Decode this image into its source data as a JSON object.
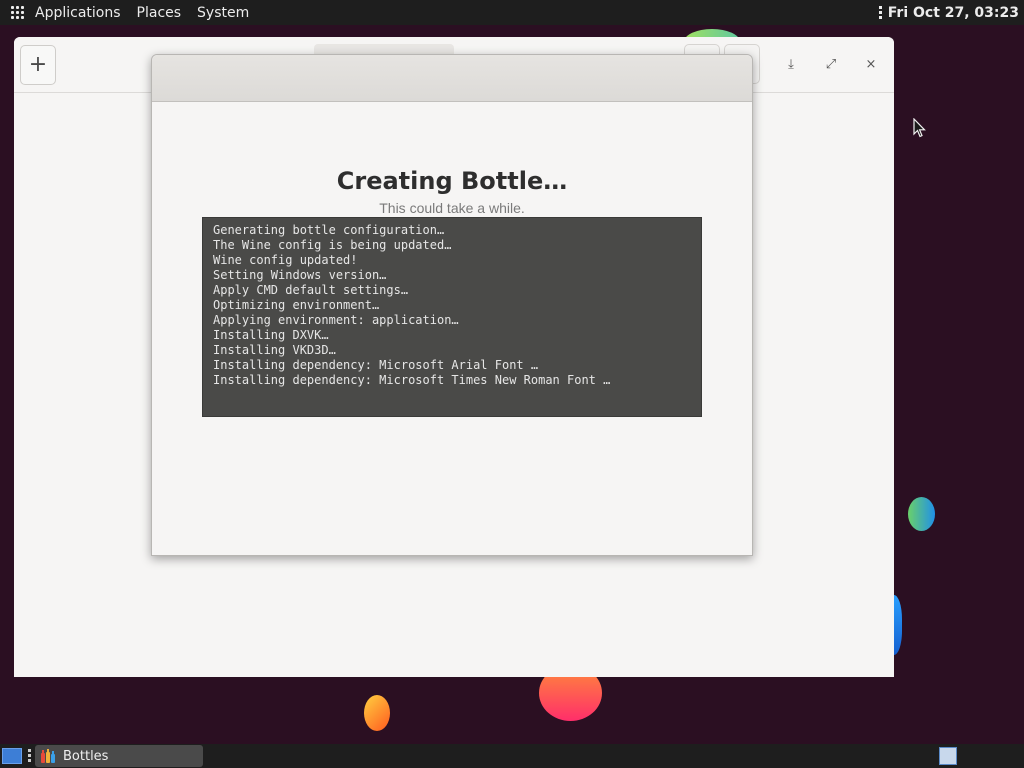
{
  "top_panel": {
    "menu": [
      "Applications",
      "Places",
      "System"
    ],
    "clock": "Fri Oct 27, 03:23"
  },
  "app_window": {
    "add_button_label": "+",
    "controls": {
      "download": "⤓",
      "maximize": "⤢",
      "close": "×"
    }
  },
  "dialog": {
    "title": "Creating Bottle…",
    "subtitle": "This could take a while.",
    "log_lines": [
      "Generating bottle configuration…",
      "The Wine config is being updated…",
      "Wine config updated!",
      "Setting Windows version…",
      "Apply CMD default settings…",
      "Optimizing environment…",
      "Applying environment: application…",
      "Installing DXVK…",
      "Installing VKD3D…",
      "Installing dependency: Microsoft Arial Font …",
      "Installing dependency: Microsoft Times New Roman Font …"
    ]
  },
  "taskbar": {
    "tasks": [
      {
        "label": "Bottles"
      }
    ]
  },
  "icons": {
    "apps": "apps-grid-icon",
    "panel_menu": "vertical-dots-icon",
    "show_desktop": "show-desktop-icon",
    "bottles": "bottles-app-icon"
  }
}
